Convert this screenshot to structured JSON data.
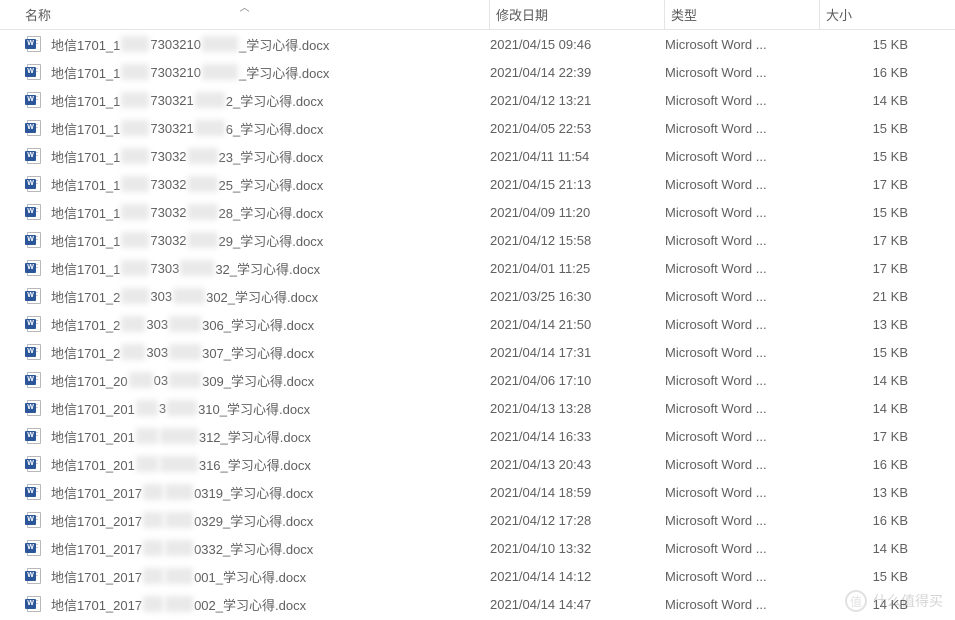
{
  "columns": {
    "name": "名称",
    "date": "修改日期",
    "type": "类型",
    "size": "大小"
  },
  "sort_indicator": "︿",
  "filetype_display": "Microsoft Word ...",
  "filename_parts": {
    "prefix": "地信1701_",
    "suffix": "_学习心得.docx"
  },
  "files": [
    {
      "pre": "地信1701_1",
      "mid1_w": 28,
      "mid2": "7303210",
      "mid3_w": 36,
      "post": "_学习心得.docx",
      "date": "2021/04/15 09:46",
      "size": "15 KB"
    },
    {
      "pre": "地信1701_1",
      "mid1_w": 28,
      "mid2": "7303210",
      "mid3_w": 36,
      "post": "_学习心得.docx",
      "date": "2021/04/14 22:39",
      "size": "16 KB"
    },
    {
      "pre": "地信1701_1",
      "mid1_w": 28,
      "mid2": "730321",
      "mid3_w": 30,
      "post": "2_学习心得.docx",
      "date": "2021/04/12 13:21",
      "size": "14 KB"
    },
    {
      "pre": "地信1701_1",
      "mid1_w": 28,
      "mid2": "730321",
      "mid3_w": 30,
      "post": "6_学习心得.docx",
      "date": "2021/04/05 22:53",
      "size": "15 KB"
    },
    {
      "pre": "地信1701_1",
      "mid1_w": 28,
      "mid2": "73032",
      "mid3_w": 30,
      "post": "23_学习心得.docx",
      "date": "2021/04/11 11:54",
      "size": "15 KB"
    },
    {
      "pre": "地信1701_1",
      "mid1_w": 28,
      "mid2": "73032",
      "mid3_w": 30,
      "post": "25_学习心得.docx",
      "date": "2021/04/15 21:13",
      "size": "17 KB"
    },
    {
      "pre": "地信1701_1",
      "mid1_w": 28,
      "mid2": "73032",
      "mid3_w": 30,
      "post": "28_学习心得.docx",
      "date": "2021/04/09 11:20",
      "size": "15 KB"
    },
    {
      "pre": "地信1701_1",
      "mid1_w": 28,
      "mid2": "73032",
      "mid3_w": 30,
      "post": "29_学习心得.docx",
      "date": "2021/04/12 15:58",
      "size": "17 KB"
    },
    {
      "pre": "地信1701_1",
      "mid1_w": 28,
      "mid2": "7303",
      "mid3_w": 34,
      "post": "32_学习心得.docx",
      "date": "2021/04/01 11:25",
      "size": "17 KB"
    },
    {
      "pre": "地信1701_2",
      "mid1_w": 28,
      "mid2": "303",
      "mid3_w": 32,
      "post": "302_学习心得.docx",
      "date": "2021/03/25 16:30",
      "size": "21 KB"
    },
    {
      "pre": "地信1701_2",
      "mid1_w": 24,
      "mid2": "303",
      "mid3_w": 32,
      "post": "306_学习心得.docx",
      "date": "2021/04/14 21:50",
      "size": "13 KB"
    },
    {
      "pre": "地信1701_2",
      "mid1_w": 24,
      "mid2": "303",
      "mid3_w": 32,
      "post": "307_学习心得.docx",
      "date": "2021/04/14 17:31",
      "size": "15 KB"
    },
    {
      "pre": "地信1701_20",
      "mid1_w": 24,
      "mid2": "03",
      "mid3_w": 32,
      "post": "309_学习心得.docx",
      "date": "2021/04/06 17:10",
      "size": "14 KB"
    },
    {
      "pre": "地信1701_201",
      "mid1_w": 22,
      "mid2": "3",
      "mid3_w": 30,
      "post": "310_学习心得.docx",
      "date": "2021/04/13 13:28",
      "size": "14 KB"
    },
    {
      "pre": "地信1701_201",
      "mid1_w": 22,
      "mid2": "",
      "mid3_w": 38,
      "post": "312_学习心得.docx",
      "date": "2021/04/14 16:33",
      "size": "17 KB"
    },
    {
      "pre": "地信1701_201",
      "mid1_w": 22,
      "mid2": "",
      "mid3_w": 38,
      "post": "316_学习心得.docx",
      "date": "2021/04/13 20:43",
      "size": "16 KB"
    },
    {
      "pre": "地信1701_2017",
      "mid1_w": 20,
      "mid2": "",
      "mid3_w": 28,
      "post": "0319_学习心得.docx",
      "date": "2021/04/14 18:59",
      "size": "13 KB"
    },
    {
      "pre": "地信1701_2017",
      "mid1_w": 20,
      "mid2": "",
      "mid3_w": 28,
      "post": "0329_学习心得.docx",
      "date": "2021/04/12 17:28",
      "size": "16 KB"
    },
    {
      "pre": "地信1701_2017",
      "mid1_w": 20,
      "mid2": "",
      "mid3_w": 28,
      "post": "0332_学习心得.docx",
      "date": "2021/04/10 13:32",
      "size": "14 KB"
    },
    {
      "pre": "地信1701_2017",
      "mid1_w": 20,
      "mid2": "",
      "mid3_w": 28,
      "post": "001_学习心得.docx",
      "date": "2021/04/14 14:12",
      "size": "15 KB"
    },
    {
      "pre": "地信1701_2017",
      "mid1_w": 20,
      "mid2": "",
      "mid3_w": 28,
      "post": "002_学习心得.docx",
      "date": "2021/04/14 14:47",
      "size": "14 KB"
    }
  ],
  "watermark": {
    "char": "值",
    "text": "什么值得买"
  }
}
